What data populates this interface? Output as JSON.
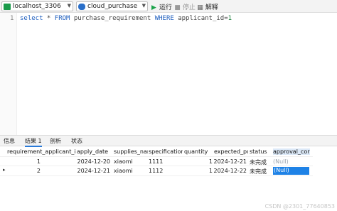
{
  "toolbar": {
    "connection": "localhost_3306",
    "database": "cloud_purchase",
    "run_label": "运行",
    "stop_label": "停止",
    "explain_label": "解释",
    "colors": {
      "connection_icon": "#1a9a4a",
      "database_icon": "#2a6fc9",
      "run_icon": "#1aa34a"
    }
  },
  "editor": {
    "line_number": "1",
    "tokens": [
      {
        "t": "select",
        "c": "kw"
      },
      {
        "t": " * ",
        "c": "op"
      },
      {
        "t": "FROM",
        "c": "kw"
      },
      {
        "t": " purchase_requirement ",
        "c": "op"
      },
      {
        "t": "WHERE",
        "c": "kw"
      },
      {
        "t": " applicant_id",
        "c": "op"
      },
      {
        "t": "=",
        "c": "op"
      },
      {
        "t": "1",
        "c": "num"
      }
    ]
  },
  "tabs": [
    {
      "label": "信息",
      "active": false
    },
    {
      "label": "结果 1",
      "active": true
    },
    {
      "label": "剖析",
      "active": false
    },
    {
      "label": "状态",
      "active": false
    }
  ],
  "grid": {
    "columns": [
      "requirement_applicant_id",
      "apply_date",
      "supplies_name",
      "specification",
      "quantity",
      "expected_pu",
      "status",
      "approval_cor"
    ],
    "rows": [
      [
        "1",
        "2024-12-20",
        "xiaomi",
        "1111",
        "1",
        "2024-12-21",
        "未完成",
        "(Null)"
      ],
      [
        "2",
        "2024-12-21",
        "xiaomi",
        "1112",
        "1",
        "2024-12-22",
        "未完成",
        "(Null)"
      ]
    ],
    "current_row_marker": "▸"
  },
  "watermark": "CSDN @2301_77640853"
}
